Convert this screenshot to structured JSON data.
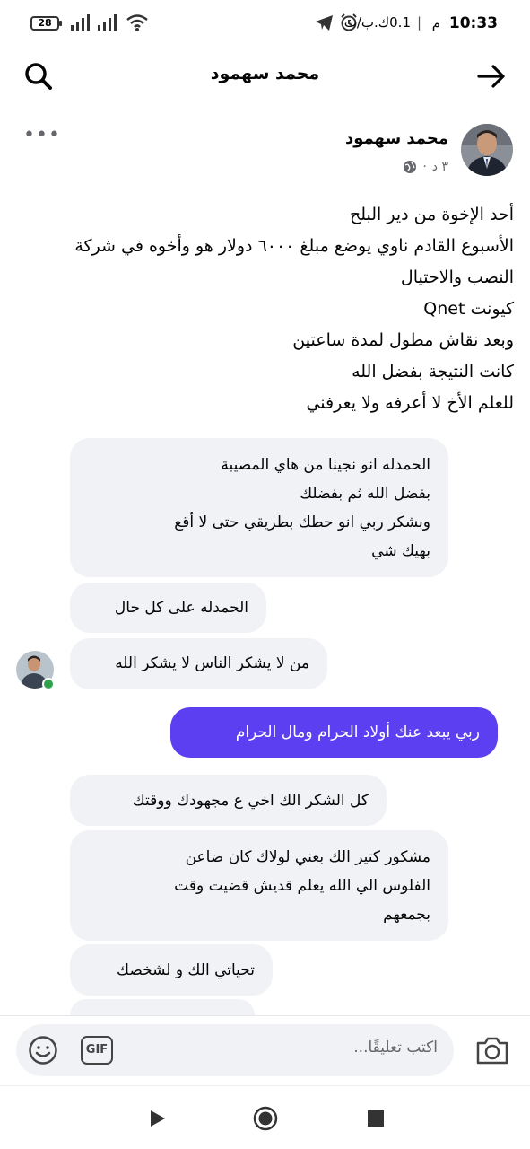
{
  "status_bar": {
    "time": "10:33",
    "ampm": "م",
    "separator": "|",
    "speed": "0.1ك.ب/ث",
    "battery": "28",
    "icons": [
      "telegram-icon",
      "alarm-icon",
      "wifi-icon",
      "signal-icon",
      "signal-icon",
      "battery-icon"
    ]
  },
  "header": {
    "title": "محمد سهمود",
    "left_icon": "search-icon",
    "right_icon": "arrow-right-icon"
  },
  "post": {
    "author": "محمد سهمود",
    "time": "٣ د",
    "privacy_icon": "globe-icon",
    "more_label": "•••",
    "lines": [
      "أحد الإخوة من دير البلح",
      "الأسبوع القادم ناوي يوضع مبلغ ٦٠٠٠ دولار هو وأخوه في شركة",
      "النصب والاحتيال",
      "كيونت Qnet",
      "وبعد نقاش مطول لمدة ساعتين",
      "كانت النتيجة بفضل الله",
      "للعلم الأخ لا أعرفه ولا يعرفني"
    ]
  },
  "comments": [
    {
      "lines": [
        "الحمدله انو نجينا من هاي المصيبة",
        "بفضل الله ثم بفضلك",
        "وبشكر ربي انو حطك بطريقي حتى لا أقع",
        "بهيك شي"
      ],
      "from": "other"
    },
    {
      "lines": [
        "الحمدله على كل حال"
      ],
      "from": "other"
    },
    {
      "lines": [
        "من لا يشكر الناس لا يشكر الله"
      ],
      "from": "other"
    },
    {
      "lines": [
        "ربي يبعد عنك أولاد الحرام ومال الحرام"
      ],
      "from": "me"
    },
    {
      "lines": [
        "كل الشكر الك اخي ع مجهودك ووقتك"
      ],
      "from": "other"
    },
    {
      "lines": [
        "مشكور كتير الك بعني لولاك كان ضاعن",
        "الفلوس الي الله يعلم قديش قضيت وقت",
        "بجمعهم"
      ],
      "from": "other"
    },
    {
      "lines": [
        "تحياتي الك و لشخصك"
      ],
      "from": "other"
    }
  ],
  "composer": {
    "placeholder": "اكتب تعليقًا...",
    "gif_label": "GIF",
    "emoji_icon": "smiley-icon",
    "camera_icon": "camera-icon"
  },
  "nav": {
    "icons": [
      "back-triangle-icon",
      "home-circle-icon",
      "recents-square-icon"
    ]
  },
  "colors": {
    "bubble_other": "#f0f2f5",
    "bubble_me": "#5b3ff0",
    "online": "#31a24c"
  }
}
